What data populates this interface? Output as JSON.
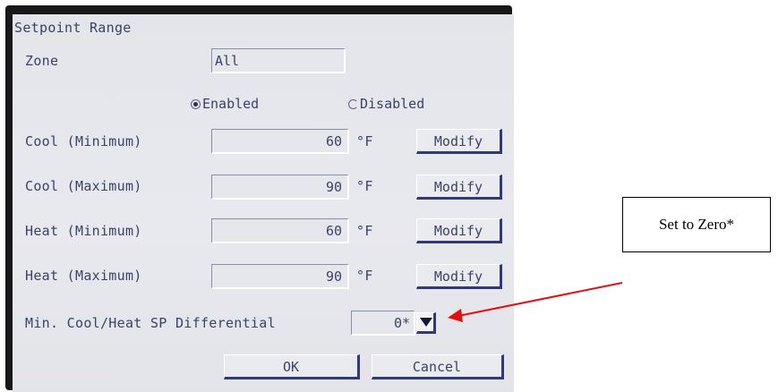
{
  "dialog": {
    "title": "Setpoint Range",
    "zone_label": "Zone",
    "zone_value": "All",
    "enabled_label": "Enabled",
    "disabled_label": "Disabled",
    "enabled_selected": true,
    "rows": [
      {
        "label": "Cool (Minimum)",
        "value": "60",
        "unit": "°F",
        "button": "Modify"
      },
      {
        "label": "Cool (Maximum)",
        "value": "90",
        "unit": "°F",
        "button": "Modify"
      },
      {
        "label": "Heat (Minimum)",
        "value": "60",
        "unit": "°F",
        "button": "Modify"
      },
      {
        "label": "Heat (Maximum)",
        "value": "90",
        "unit": "°F",
        "button": "Modify"
      }
    ],
    "differential_label": "Min. Cool/Heat SP Differential",
    "differential_value": "0*",
    "ok_label": "OK",
    "cancel_label": "Cancel"
  },
  "annotation": {
    "text": "Set to Zero*",
    "arrow_color": "#e01010"
  },
  "icons": {
    "dropdown": "triangle-down-icon"
  }
}
